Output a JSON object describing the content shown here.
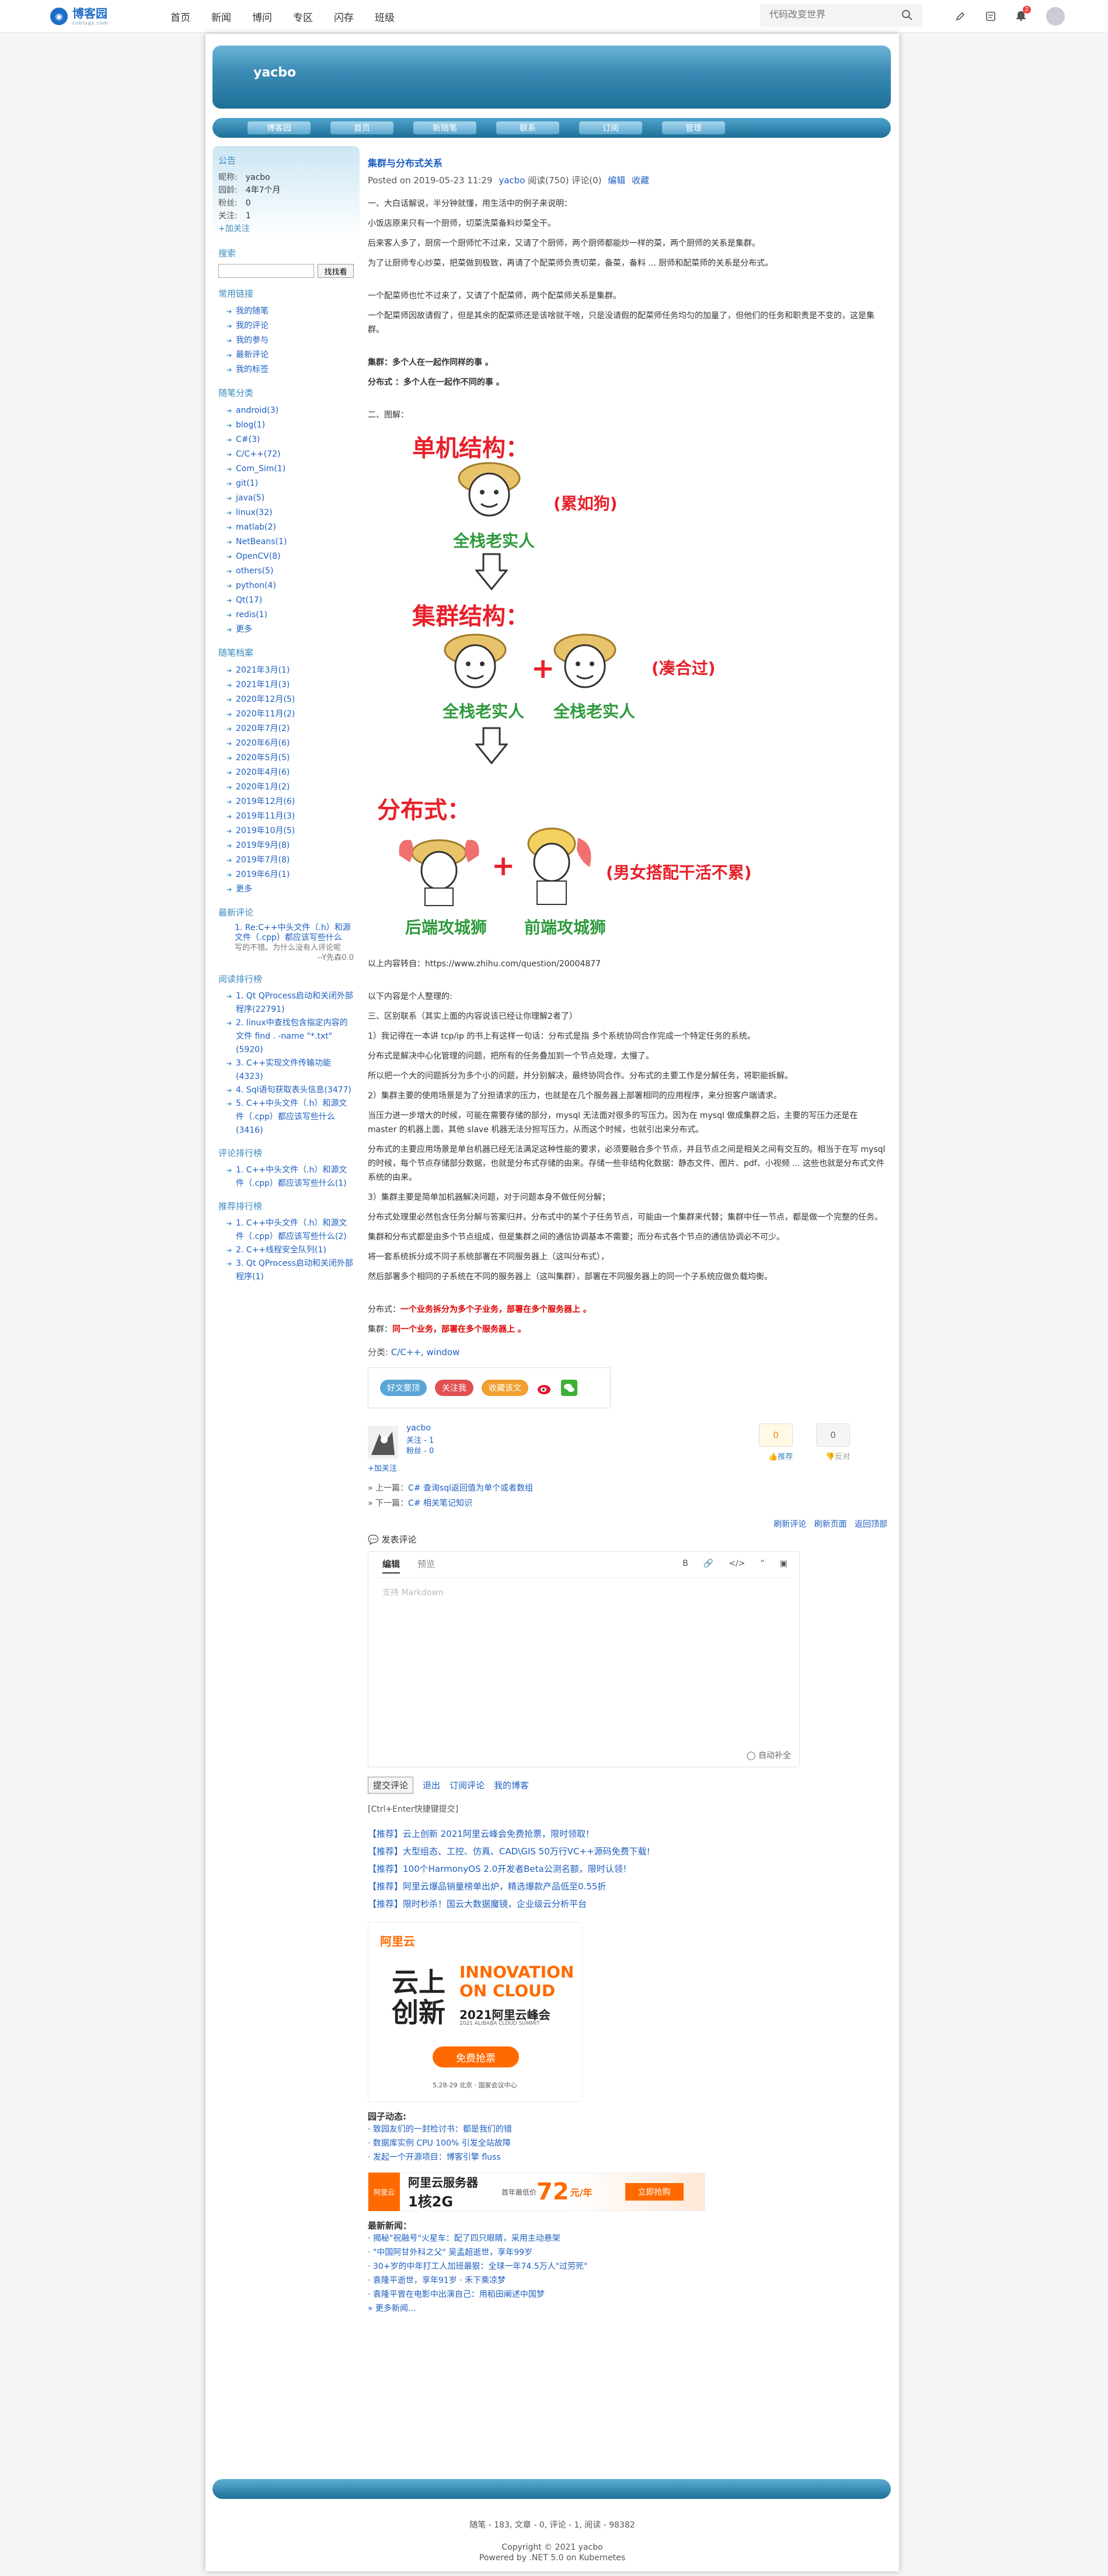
{
  "topbar": {
    "logo_cn": "博客园",
    "logo_en": "cnblogs.com",
    "nav": [
      "首页",
      "新闻",
      "博问",
      "专区",
      "闪存",
      "班级"
    ],
    "search_placeholder": "代码改变世界",
    "bell_badge": "2"
  },
  "blog": {
    "title": "yacbo",
    "nav": [
      "博客园",
      "首页",
      "新随笔",
      "联系",
      "订阅",
      "管理"
    ]
  },
  "sidebar": {
    "notice_title": "公告",
    "profile": [
      {
        "label": "昵称:",
        "value": "yacbo"
      },
      {
        "label": "园龄:",
        "value": "4年7个月"
      },
      {
        "label": "粉丝:",
        "value": "0"
      },
      {
        "label": "关注:",
        "value": "1"
      }
    ],
    "follow": "+加关注",
    "search_title": "搜索",
    "search_button": "找找看",
    "links_title": "常用链接",
    "links": [
      "我的随笔",
      "我的评论",
      "我的参与",
      "最新评论",
      "我的标签"
    ],
    "categories_title": "随笔分类",
    "categories": [
      "android(3)",
      "blog(1)",
      "C#(3)",
      "C/C++(72)",
      "Com_Sim(1)",
      "git(1)",
      "java(5)",
      "linux(32)",
      "matlab(2)",
      "NetBeans(1)",
      "OpenCV(8)",
      "others(5)",
      "python(4)",
      "Qt(17)",
      "redis(1)",
      "更多"
    ],
    "archives_title": "随笔档案",
    "archives": [
      "2021年3月(1)",
      "2021年1月(3)",
      "2020年12月(5)",
      "2020年11月(2)",
      "2020年7月(2)",
      "2020年6月(6)",
      "2020年5月(5)",
      "2020年4月(6)",
      "2020年1月(2)",
      "2019年12月(6)",
      "2019年11月(3)",
      "2019年10月(5)",
      "2019年9月(8)",
      "2019年7月(8)",
      "2019年6月(1)",
      "更多"
    ],
    "recent_comments_title": "最新评论",
    "recent_comment_link": "1. Re:C++中头文件（.h）和源文件（.cpp）都应该写些什么",
    "recent_comment_body": "写的不错。为什么没有人评论呢",
    "recent_comment_author": "--Y先森0.0",
    "reading_title": "阅读排行榜",
    "reading": [
      "1. Qt QProcess启动和关闭外部程序(22791)",
      "2. linux中查找包含指定内容的文件 find . -name \"*.txt\"(5920)",
      "3. C++实现文件传输功能(4323)",
      "4. Sql语句获取表头信息(3477)",
      "5. C++中头文件（.h）和源文件（.cpp）都应该写些什么(3416)"
    ],
    "comment_rank_title": "评论排行榜",
    "comment_rank": [
      "1. C++中头文件（.h）和源文件（.cpp）都应该写些什么(1)"
    ],
    "recommend_title": "推荐排行榜",
    "recommend": [
      "1. C++中头文件（.h）和源文件（.cpp）都应该写些什么(2)",
      "2. C++线程安全队列(1)",
      "3. Qt QProcess启动和关闭外部程序(1)"
    ]
  },
  "post": {
    "title": "集群与分布式关系",
    "posted": "Posted on 2019-05-23 11:29",
    "author": "yacbo",
    "reads": "阅读(750)",
    "comments": "评论(0)",
    "edit": "编辑",
    "fav": "收藏",
    "para1": "一、大白话解说，半分钟就懂，用生活中的例子来说明：",
    "para2": "小饭店原来只有一个厨师，切菜洗菜备料炒菜全干。",
    "para3": "后来客人多了，厨房一个厨师忙不过来，又请了个厨师，两个厨师都能炒一样的菜，两个厨师的关系是集群。",
    "para4": "为了让厨师专心炒菜，把菜做到极致，再请了个配菜师负责切菜，备菜，备料 ... 厨师和配菜师的关系是分布式。",
    "para5": "一个配菜师也忙不过来了，又请了个配菜师，两个配菜师关系是集群。",
    "para6": "一个配菜师因故请假了，但是其余的配菜师还是该啥就干啥，只是没请假的配菜师任务均匀的加量了，但他们的任务和职责是不变的，这是集群。",
    "cluster_def": "集群：多个人在一起作同样的事 。",
    "dist_def": "分布式 ：多个人在一起作不同的事 。",
    "section2": "二、图解：",
    "diagram": {
      "single_head": "单机结构：",
      "single_note": "(累如狗)",
      "fullstack": "全栈老实人",
      "cluster_head": "集群结构：",
      "cluster_note": "(凑合过)",
      "dist_head": "分布式：",
      "dist_note": "(男女搭配干活不累)",
      "backend": "后端攻城狮",
      "frontend": "前端攻城狮",
      "plus": "+"
    },
    "source": "以上内容转自：https://www.zhihu.com/question/20004877",
    "personal": "以下内容是个人整理的:",
    "section3": "三、区别联系（其实上面的内容说该已经让你理解2者了）",
    "p3_1": "1）我记得在一本讲 tcp/ip 的书上有这样一句话：分布式是指 多个系统协同合作完成一个特定任务的系统。",
    "p3_2": "分布式是解决中心化管理的问题，把所有的任务叠加到一个节点处理，太慢了。",
    "p3_3": "所以把一个大的问题拆分为多个小的问题，并分别解决，最终协同合作。分布式的主要工作是分解任务，将职能拆解。",
    "p3_4": "2）集群主要的使用场景是为了分担请求的压力，也就是在几个服务器上部署相同的应用程序，来分担客户端请求。",
    "p3_5": "当压力进一步增大的时候，可能在需要存储的部分，mysql 无法面对很多的写压力。因为在 mysql 做成集群之后，主要的写压力还是在 master 的机器上面，其他 slave 机器无法分担写压力，从而这个时候，也就引出来分布式。",
    "p3_6": "分布式的主要应用场景是单台机器已经无法满足这种性能的要求，必须要融合多个节点，并且节点之间是相关之间有交互的。相当于在写 mysql 的时候，每个节点存储部分数据，也就是分布式存储的由来。存储一些非结构化数据：静态文件、图片、pdf、小视频 ... 这些也就是分布式文件系统的由来。",
    "p3_7": "3）集群主要是简单加机器解决问题，对于问题本身不做任何分解；",
    "p3_8": "分布式处理里必然包含任务分解与答案归并。分布式中的某个子任务节点，可能由一个集群来代替；集群中任一节点，都是做一个完整的任务。",
    "p3_9": "集群和分布式都是由多个节点组成，但是集群之间的通信协调基本不需要；而分布式各个节点的通信协调必不可少。",
    "p3_10": "将一套系统拆分成不同子系统部署在不同服务器上（这叫分布式），",
    "p3_11": "然后部署多个相同的子系统在不同的服务器上（这叫集群），部署在不同服务器上的同一个子系统应做负载均衡。",
    "summary_dist_label": "分布式：",
    "summary_dist": "一个业务拆分为多个子业务，部署在多个服务器上 。",
    "summary_cluster_label": "集群：",
    "summary_cluster": "同一个业务，部署在多个服务器上 。",
    "category_label": "分类:",
    "category_links": "C/C++, window",
    "share": [
      "好文要顶",
      "关注我",
      "收藏该文"
    ]
  },
  "author_box": {
    "name": "yacbo",
    "follow_line": "关注 - 1",
    "fans_line": "粉丝 - 0",
    "follow_btn": "+加关注",
    "digg_count": "0",
    "bury_count": "0",
    "digg_label": "推荐",
    "bury_label": "反对"
  },
  "prevnext": {
    "prev_label": "» 上一篇：",
    "prev": "C# 查询sql返回值为单个或者数组",
    "next_label": "» 下一篇：",
    "next": "C# 相关笔记知识"
  },
  "comment": {
    "links": [
      "刷新评论",
      "刷新页面",
      "返回顶部"
    ],
    "title": "发表评论",
    "tab_edit": "编辑",
    "tab_preview": "预览",
    "placeholder": "支持 Markdown",
    "autosave": "自动补全",
    "submit": "提交评论",
    "logout": "退出",
    "subscribe": "订阅评论",
    "myblog": "我的博客",
    "shortcut": "[Ctrl+Enter快捷键提交]"
  },
  "recommends": [
    "【推荐】云上创新 2021阿里云峰会免费抢票，限时领取！",
    "【推荐】大型组态、工控、仿真、CAD\\GIS 50万行VC++源码免费下载!",
    "【推荐】100个HarmonyOS 2.0开发者Beta公测名额，限时认领！",
    "【推荐】阿里云爆品销量榜单出炉，精选爆款产品低至0.55折",
    "【推荐】限时秒杀！国云大数据魔镜，企业级云分析平台"
  ],
  "ad_big": {
    "brand": "阿里云",
    "big1": "云上",
    "big2": "创新",
    "eng1": "INNOVATION",
    "eng2": "ON CLOUD",
    "summit": "2021阿里云峰会",
    "summit_en": "2021 ALIBABA CLOUD SUMMIT",
    "cta": "免费抢票",
    "date": "5.28-29  北京 · 国家会议中心"
  },
  "peer_news_title": "园子动态:",
  "peer_news": [
    "· 致园友们的一封检讨书：都是我们的错",
    "· 数据库实例 CPU 100% 引发全站故障",
    "· 发起一个开源项目：博客引擎 fluss"
  ],
  "ad_wide": {
    "brand": "阿里云",
    "title": "阿里云服务器",
    "spec": "1核2G",
    "price_label": "首年最低价",
    "price": "72",
    "unit": "元/年",
    "cta": "立即抢购"
  },
  "latest_news_title": "最新新闻：",
  "latest_news": [
    "· 揭秘\"祝融号\"火星车：配了四只眼睛，采用主动悬架",
    "· \"中国阿甘外科之父\" 吴孟超逝世，享年99岁",
    "· 30+岁的中年打工人加班最狠：全球一年74.5万人\"过劳死\"",
    "· 袁隆平逝世，享年91岁 · 禾下乘凉梦",
    "· 袁隆平曾在电影中出演自己：用稻田阐述中国梦",
    "» 更多新闻..."
  ],
  "footer": {
    "stats": "随笔 - 183, 文章 - 0, 评论 - 1, 阅读 - 98382",
    "copyright": "Copyright © 2021 yacbo",
    "powered": "Powered by .NET 5.0 on Kubernetes"
  }
}
